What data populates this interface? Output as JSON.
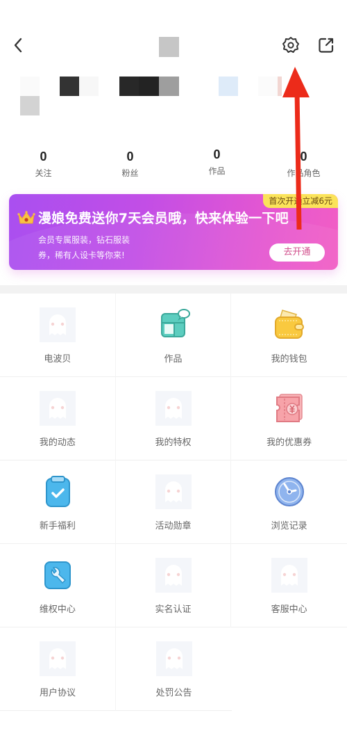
{
  "header": {
    "back_icon": "chevron-left-icon",
    "settings_icon": "gear-icon",
    "share_icon": "external-share-icon"
  },
  "stats": [
    {
      "value": "0",
      "label": "关注"
    },
    {
      "value": "0",
      "label": "粉丝"
    },
    {
      "value": "0",
      "label": "作品"
    },
    {
      "value": "0",
      "label": "作品角色"
    }
  ],
  "vip_banner": {
    "tag": "首次开通立减6元",
    "title": "漫娘免费送你7天会员哦，快来体验一下吧",
    "desc_line1": "会员专属服装，钻石服装",
    "desc_line2": "券，稀有人设卡等你来!",
    "button": "去开通",
    "colors": {
      "gradient_start": "#a94ff0",
      "gradient_end": "#f25ec4",
      "tag_bg": "#fbe35a",
      "button_text": "#d2508d"
    }
  },
  "menu": [
    {
      "label": "电波贝",
      "icon": "placeholder-ghost-icon"
    },
    {
      "label": "作品",
      "icon": "works-icon"
    },
    {
      "label": "我的钱包",
      "icon": "wallet-icon"
    },
    {
      "label": "我的动态",
      "icon": "placeholder-ghost-icon"
    },
    {
      "label": "我的特权",
      "icon": "placeholder-ghost-icon"
    },
    {
      "label": "我的优惠券",
      "icon": "coupon-icon"
    },
    {
      "label": "新手福利",
      "icon": "clipboard-check-icon"
    },
    {
      "label": "活动勋章",
      "icon": "placeholder-ghost-icon"
    },
    {
      "label": "浏览记录",
      "icon": "clock-icon"
    },
    {
      "label": "维权中心",
      "icon": "wrench-icon"
    },
    {
      "label": "实名认证",
      "icon": "placeholder-ghost-icon"
    },
    {
      "label": "客服中心",
      "icon": "placeholder-ghost-icon"
    },
    {
      "label": "用户协议",
      "icon": "placeholder-ghost-icon"
    },
    {
      "label": "处罚公告",
      "icon": "placeholder-ghost-icon"
    }
  ],
  "annotation": {
    "type": "red-arrow",
    "points_to": "settings"
  }
}
